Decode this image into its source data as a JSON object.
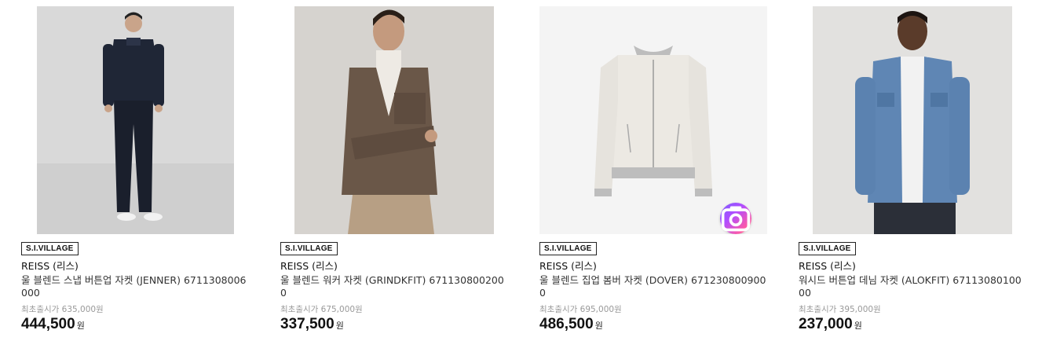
{
  "products": [
    {
      "mall": "S.I.VILLAGE",
      "brand": "REISS (리스)",
      "name": "울 블렌드 스냅 버튼업 자켓 (JENNER) 6711308006000",
      "orig_price": "최초출시가 635,000원",
      "price": "444,500",
      "currency": "원",
      "image_icon": "man-navy-jacket-photo"
    },
    {
      "mall": "S.I.VILLAGE",
      "brand": "REISS (리스)",
      "name": "울 블렌드 워커 자켓 (GRINDKFIT) 6711308002000",
      "orig_price": "최초출시가 675,000원",
      "price": "337,500",
      "currency": "원",
      "image_icon": "man-brown-jacket-photo"
    },
    {
      "mall": "S.I.VILLAGE",
      "brand": "REISS (리스)",
      "name": "울 블렌드 집업 봄버 자켓 (DOVER) 6712308009000",
      "orig_price": "최초출시가 695,000원",
      "price": "486,500",
      "currency": "원",
      "image_icon": "white-bomber-jacket-photo",
      "badge_icon": "camera-search-icon"
    },
    {
      "mall": "S.I.VILLAGE",
      "brand": "REISS (리스)",
      "name": "워시드 버튼업 데님 자켓 (ALOKFIT) 6711308010000",
      "orig_price": "최초출시가 395,000원",
      "price": "237,000",
      "currency": "원",
      "image_icon": "man-denim-jacket-photo"
    }
  ]
}
